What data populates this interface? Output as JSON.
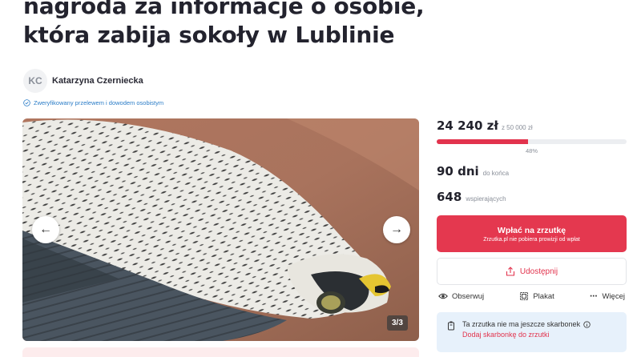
{
  "title": "nagroda za informacje o osobie, która zabija sokoły w Lublinie",
  "author": {
    "initials": "KC",
    "name": "Katarzyna Czerniecka"
  },
  "verified_text": "Zweryfikowany przelewem i dowodem osobistym",
  "gallery": {
    "counter": "3/3",
    "prev_icon": "arrow-left-icon",
    "next_icon": "arrow-right-icon"
  },
  "stats": {
    "raised": "24 240 zł",
    "goal": "z 50 000 zł",
    "percent_label": "48%",
    "percent": 48,
    "days_value": "90 dni",
    "days_label": "do końca",
    "supporters_value": "648",
    "supporters_label": "wspierających"
  },
  "donate": {
    "label": "Wpłać na zrzutkę",
    "sublabel": "Zrzutka.pl nie pobiera prowizji od wpłat"
  },
  "share": {
    "label": "Udostępnij"
  },
  "actions": {
    "follow": "Obserwuj",
    "poster": "Plakat",
    "more": "Więcej"
  },
  "piggybank": {
    "text": "Ta zrzutka nie ma jeszcze skarbonek",
    "link": "Dodaj skarbonkę do zrzutki"
  },
  "colors": {
    "accent": "#e2334d",
    "verified": "#2a7cc7",
    "info_bg": "#e7f1fb"
  }
}
